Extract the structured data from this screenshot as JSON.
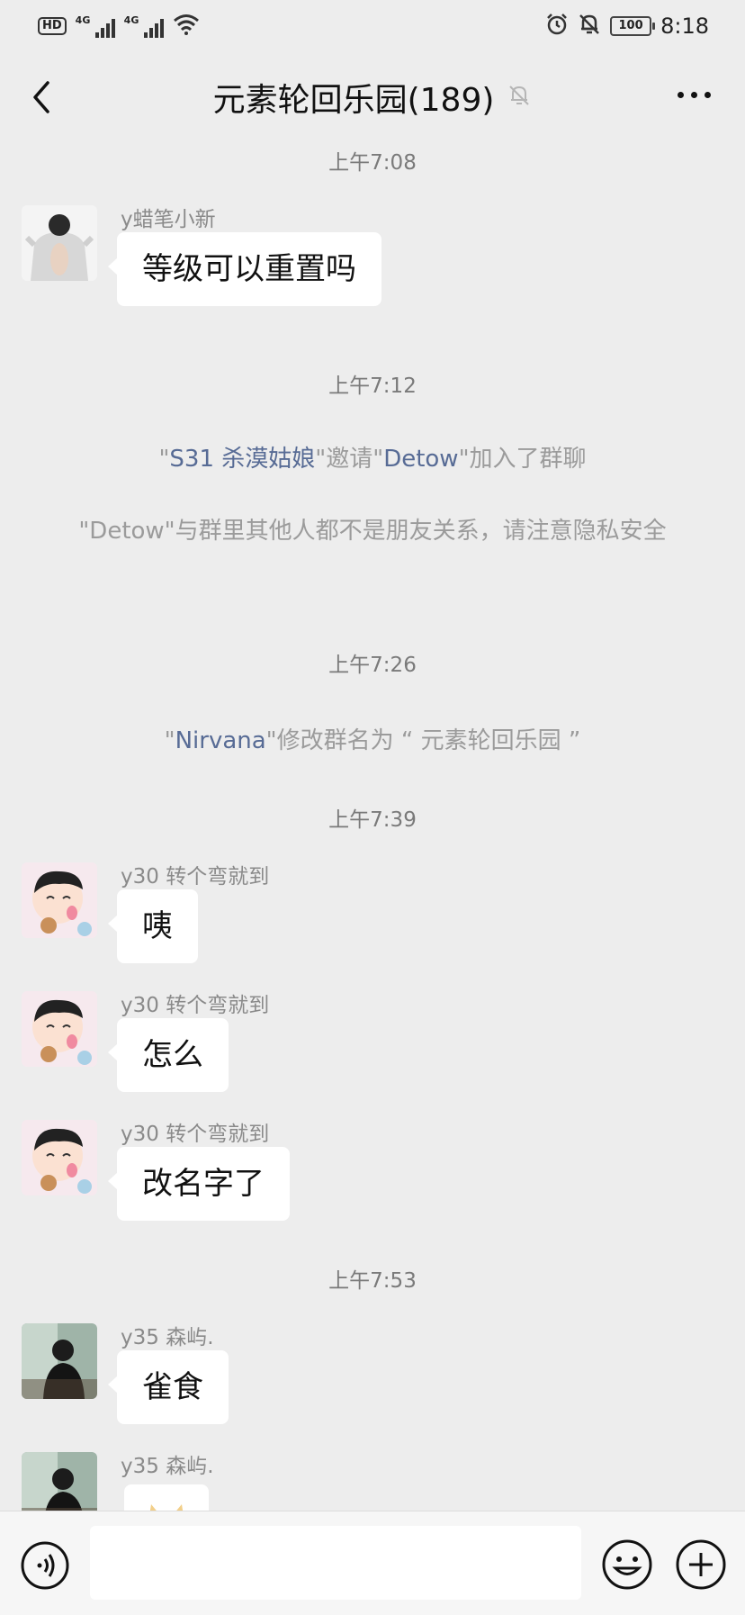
{
  "status_bar": {
    "hd_label": "HD",
    "network_1": "4G",
    "network_2": "4G",
    "battery": "100",
    "time": "8:18"
  },
  "header": {
    "title": "元素轮回乐园(189)",
    "icons": [
      "back-icon",
      "bell-muted-icon",
      "more-icon"
    ]
  },
  "chat": {
    "items": [
      {
        "kind": "timestamp",
        "text": "上午7:08"
      },
      {
        "kind": "message",
        "sender": "y蜡笔小新",
        "text": "等级可以重置吗",
        "avatar": "white-shirt-photo"
      },
      {
        "kind": "timestamp",
        "text": "上午7:12"
      },
      {
        "kind": "system",
        "q1": "\"",
        "name1": "S31 杀漠姑娘",
        "mid": "\"邀请\"",
        "name2": "Detow",
        "tail": "\"加入了群聊"
      },
      {
        "kind": "system_note",
        "text": "\"Detow\"与群里其他人都不是朋友关系，请注意隐私安全"
      },
      {
        "kind": "timestamp",
        "text": "上午7:26"
      },
      {
        "kind": "system_rename",
        "q1": "\"",
        "name": "Nirvana",
        "tail": "\"修改群名为 “ 元素轮回乐园 ”"
      },
      {
        "kind": "timestamp",
        "text": "上午7:39"
      },
      {
        "kind": "message",
        "sender": "y30 转个弯就到",
        "text": "咦",
        "avatar": "cartoon-boy"
      },
      {
        "kind": "message",
        "sender": "y30 转个弯就到",
        "text": "怎么",
        "avatar": "cartoon-boy"
      },
      {
        "kind": "message",
        "sender": "y30 转个弯就到",
        "text": "改名字了",
        "avatar": "cartoon-boy"
      },
      {
        "kind": "timestamp",
        "text": "上午7:53"
      },
      {
        "kind": "message",
        "sender": "y35 森屿.",
        "text": "雀食",
        "avatar": "silhouette-photo"
      },
      {
        "kind": "message",
        "sender": "y35 森屿.",
        "text": "",
        "avatar": "silhouette-photo",
        "content": "sticker"
      }
    ]
  },
  "input_bar": {
    "value": "",
    "icons": [
      "voice-icon",
      "emoji-icon",
      "plus-icon"
    ]
  },
  "colors": {
    "background": "#ededed",
    "bubble": "#ffffff",
    "link_name": "#576b95",
    "system_text": "#9b9b9b"
  }
}
